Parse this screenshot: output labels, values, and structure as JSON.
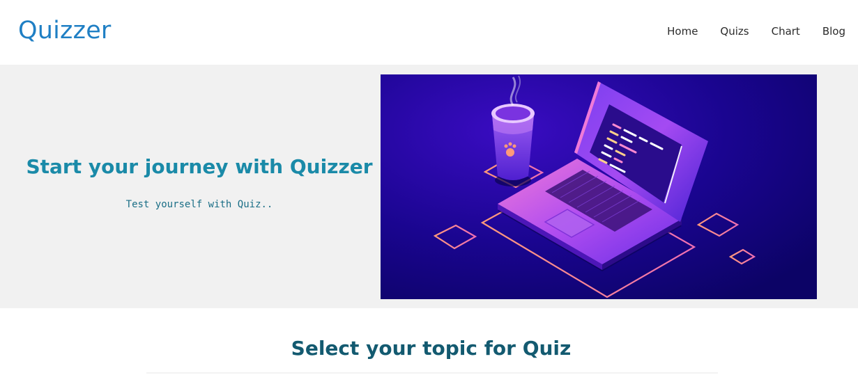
{
  "brand": "Quizzer",
  "nav": {
    "home": "Home",
    "quizs": "Quizs",
    "chart": "Chart",
    "blog": "Blog"
  },
  "hero": {
    "title": "Start your journey with Quizzer",
    "subtitle": "Test yourself with Quiz.."
  },
  "section": {
    "title": "Select your topic for Quiz"
  },
  "colors": {
    "brand": "#1f7fc4",
    "hero_title": "#1a8aa8",
    "section_title": "#135a70",
    "hero_bg": "#f1f1f1"
  },
  "icons": {
    "hero_illustration": "laptop-coffee-illustration"
  }
}
